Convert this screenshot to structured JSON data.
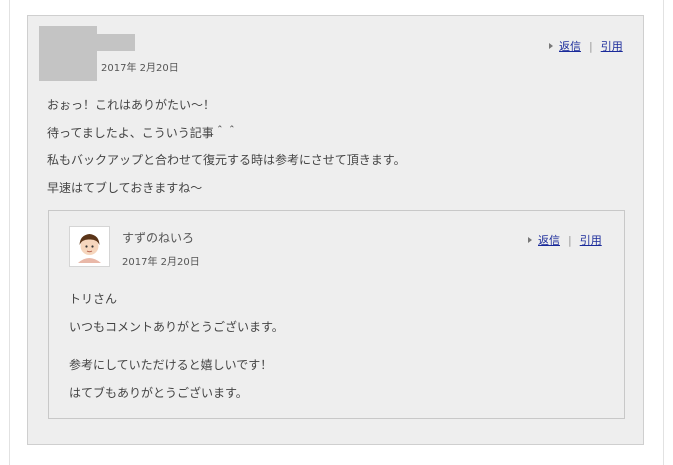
{
  "comment": {
    "date": "2017年 2月20日",
    "actions": {
      "reply": "返信",
      "quote": "引用",
      "separator": "|"
    },
    "body": [
      "おぉっ！これはありがたい～！",
      "待ってましたよ、こういう記事＾＾",
      "私もバックアップと合わせて復元する時は参考にさせて頂きます。",
      "早速はてブしておきますね～"
    ]
  },
  "reply": {
    "author": "すずのねいろ",
    "date": "2017年 2月20日",
    "actions": {
      "reply": "返信",
      "quote": "引用",
      "separator": "|"
    },
    "body": [
      "トリさん",
      "いつもコメントありがとうございます。",
      "参考にしていただけると嬉しいです！",
      "はてブもありがとうございます。"
    ]
  },
  "icons": {
    "action_marker": "triangle-right-icon",
    "reply_avatar": "avatar-icon"
  }
}
